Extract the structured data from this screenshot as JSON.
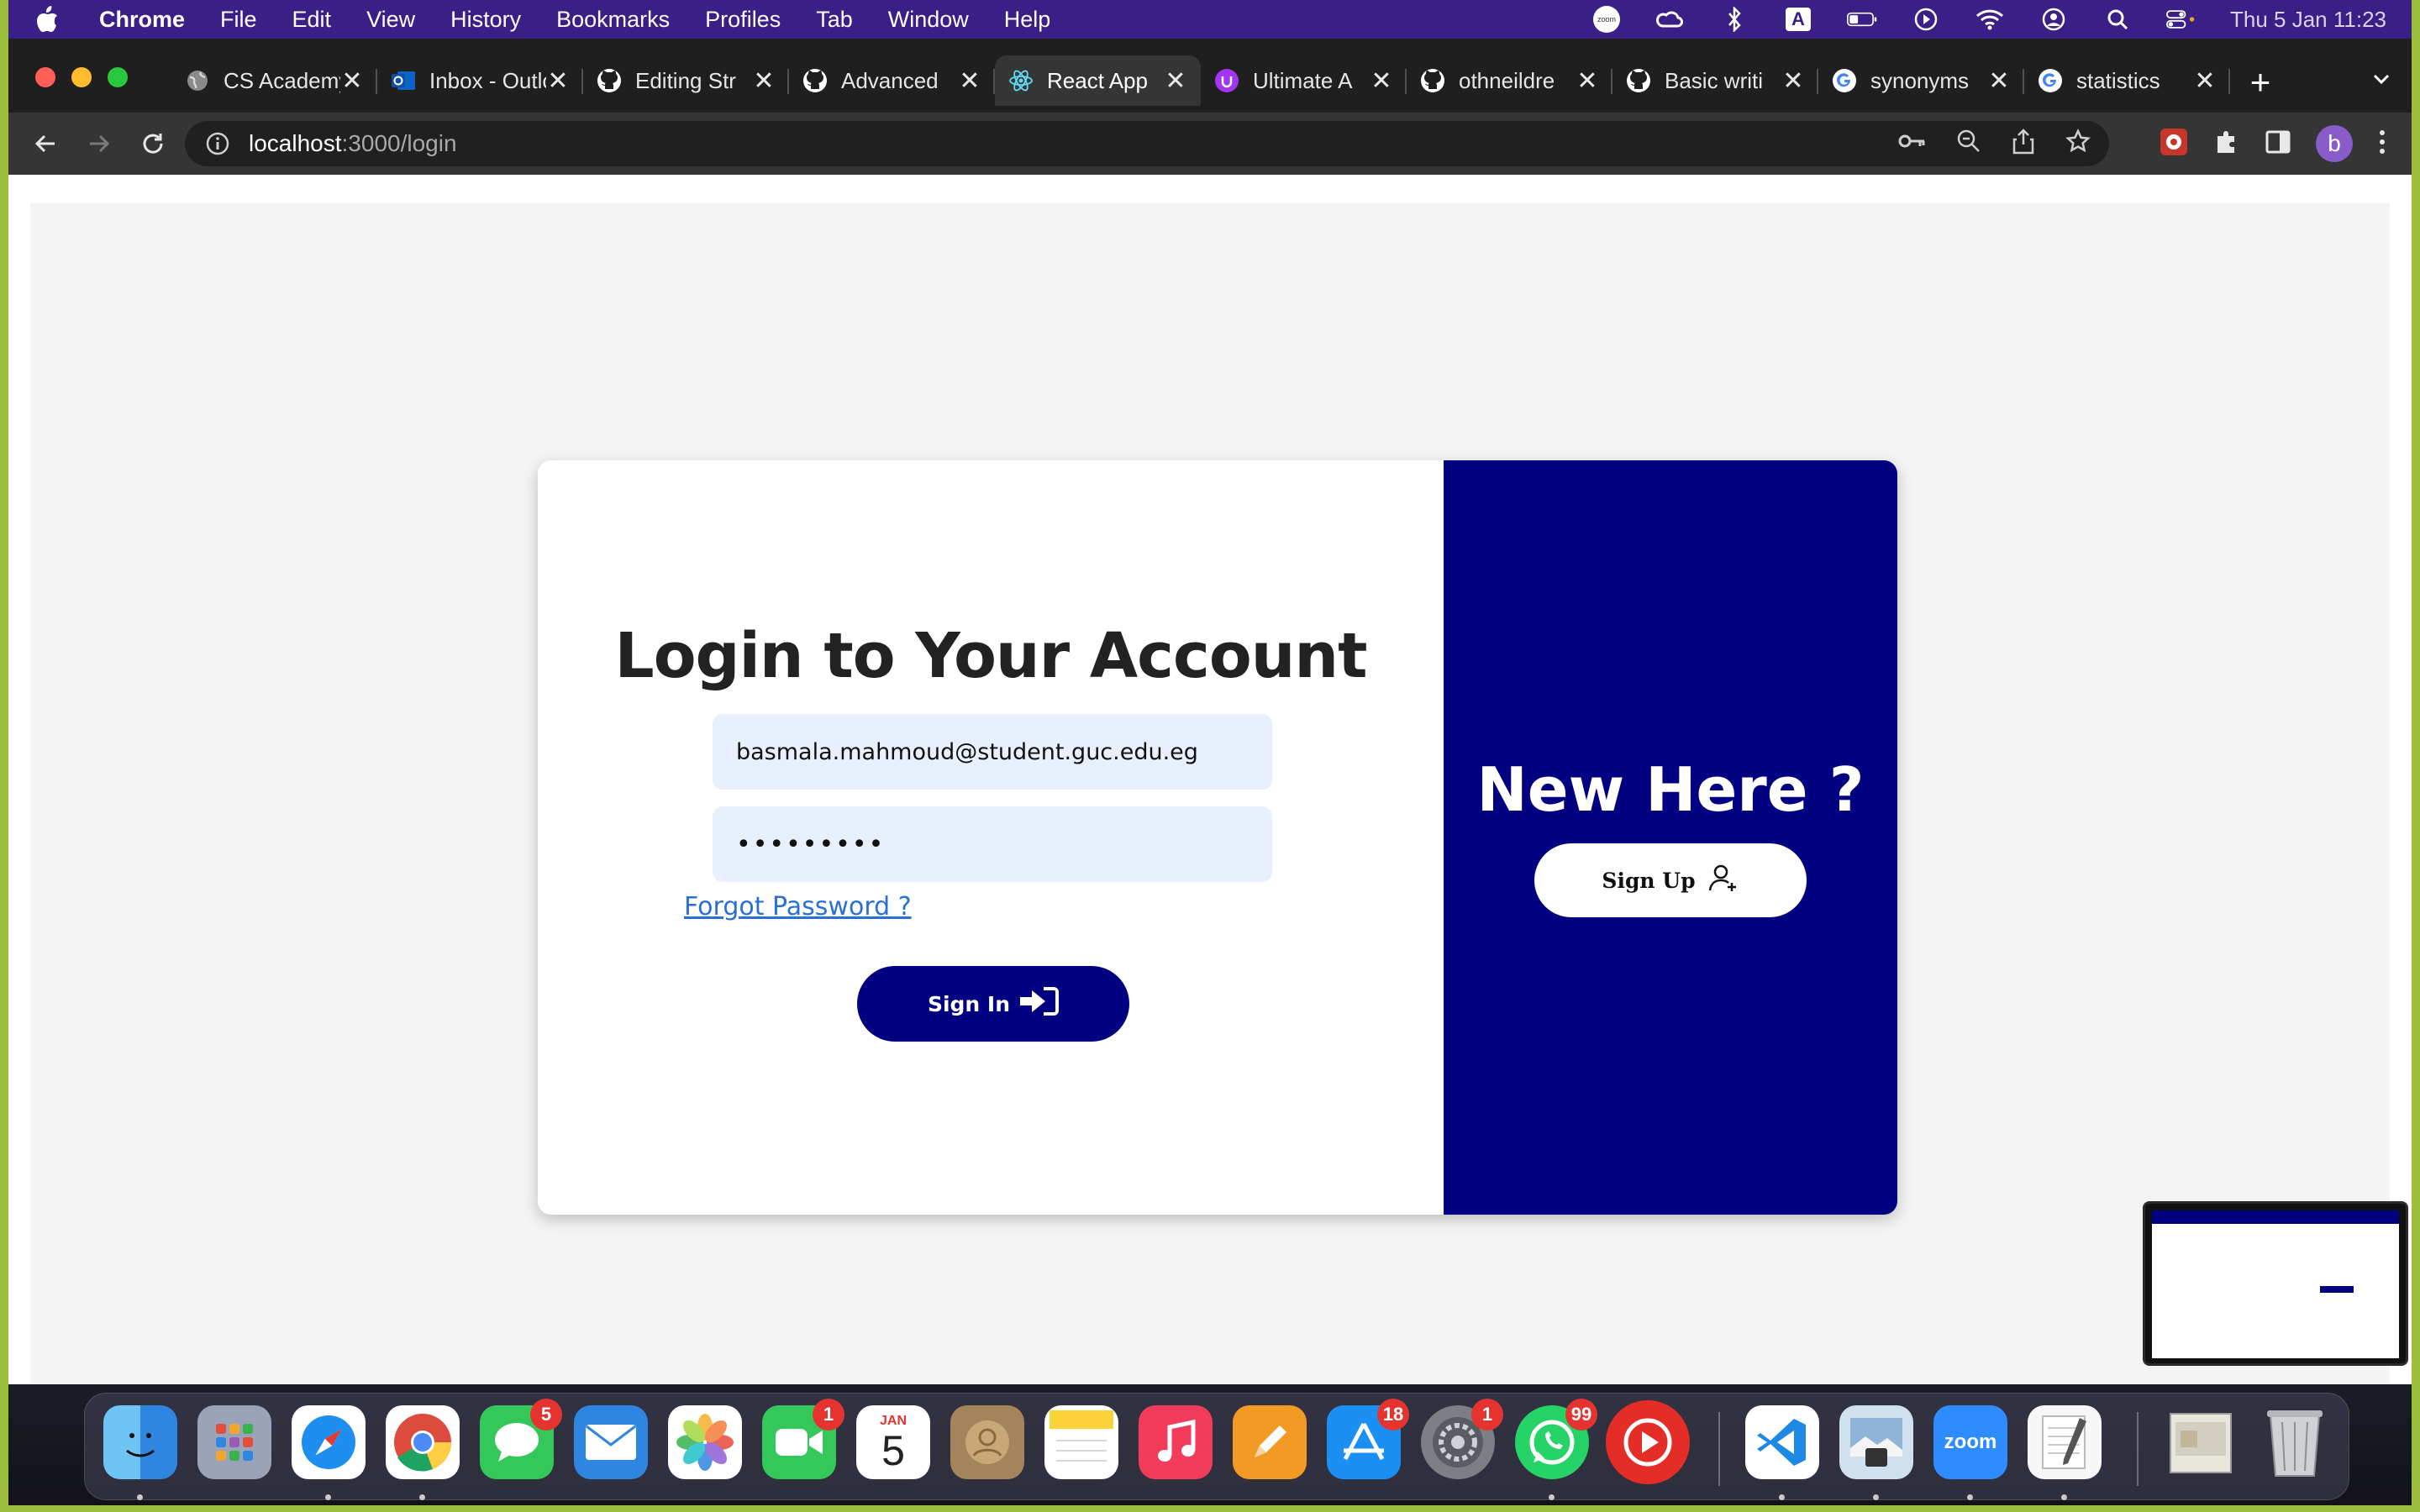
{
  "menubar": {
    "app_name": "Chrome",
    "items": [
      "File",
      "Edit",
      "View",
      "History",
      "Bookmarks",
      "Profiles",
      "Tab",
      "Window",
      "Help"
    ],
    "clock": "Thu 5 Jan  11:23",
    "status_icons": [
      "zoom-icon",
      "creative-cloud-icon",
      "bluetooth-icon",
      "keyboard-input-icon",
      "battery-icon",
      "play-icon",
      "wifi-icon",
      "user-icon",
      "search-icon",
      "control-center-icon"
    ],
    "zoom_label": "zoom",
    "input_label": "A"
  },
  "tabs": [
    {
      "title": "CS Academy",
      "icon": "globe-icon"
    },
    {
      "title": "Inbox - Outlook",
      "icon": "outlook-icon"
    },
    {
      "title": "Editing Str",
      "icon": "github-icon"
    },
    {
      "title": "Advanced",
      "icon": "github-icon"
    },
    {
      "title": "React App",
      "icon": "react-icon",
      "active": true
    },
    {
      "title": "Ultimate A",
      "icon": "udemy-icon"
    },
    {
      "title": "othneildre",
      "icon": "github-icon"
    },
    {
      "title": "Basic writi",
      "icon": "github-icon"
    },
    {
      "title": "synonyms",
      "icon": "google-icon"
    },
    {
      "title": "statistics",
      "icon": "google-icon"
    }
  ],
  "toolbar": {
    "url_host": "localhost",
    "url_path": ":3000/login",
    "avatar_letter": "b"
  },
  "login": {
    "title": "Login to Your Account",
    "email_value": "basmala.mahmoud@student.guc.edu.eg",
    "password_value": "•••••••••",
    "forgot_label": "Forgot Password ?",
    "signin_label": "Sign In"
  },
  "signup_panel": {
    "heading": "New Here ?",
    "signup_label": "Sign Up"
  },
  "dock": {
    "apps": [
      {
        "name": "finder",
        "badge": ""
      },
      {
        "name": "launchpad",
        "badge": ""
      },
      {
        "name": "safari",
        "badge": ""
      },
      {
        "name": "chrome",
        "badge": ""
      },
      {
        "name": "messages",
        "badge": "5"
      },
      {
        "name": "mail",
        "badge": ""
      },
      {
        "name": "photos",
        "badge": ""
      },
      {
        "name": "facetime",
        "badge": "1"
      },
      {
        "name": "calendar",
        "badge": ""
      },
      {
        "name": "contacts",
        "badge": ""
      },
      {
        "name": "notes",
        "badge": ""
      },
      {
        "name": "music",
        "badge": ""
      },
      {
        "name": "pages",
        "badge": ""
      },
      {
        "name": "app-store",
        "badge": "18"
      },
      {
        "name": "system-preferences",
        "badge": "1"
      },
      {
        "name": "whatsapp",
        "badge": "99"
      },
      {
        "name": "youtube-music",
        "badge": ""
      },
      {
        "name": "vscode",
        "badge": ""
      },
      {
        "name": "preview",
        "badge": ""
      },
      {
        "name": "zoom",
        "badge": ""
      },
      {
        "name": "textedit",
        "badge": ""
      },
      {
        "name": "downloads",
        "badge": ""
      },
      {
        "name": "trash",
        "badge": ""
      }
    ],
    "calendar_month": "JAN",
    "calendar_day": "5",
    "zoom_label": "zoom"
  },
  "colors": {
    "brand_navy": "#000080",
    "input_bg": "#e8f0fe",
    "link": "#2a6fd6",
    "menubar": "#3a1f86"
  }
}
